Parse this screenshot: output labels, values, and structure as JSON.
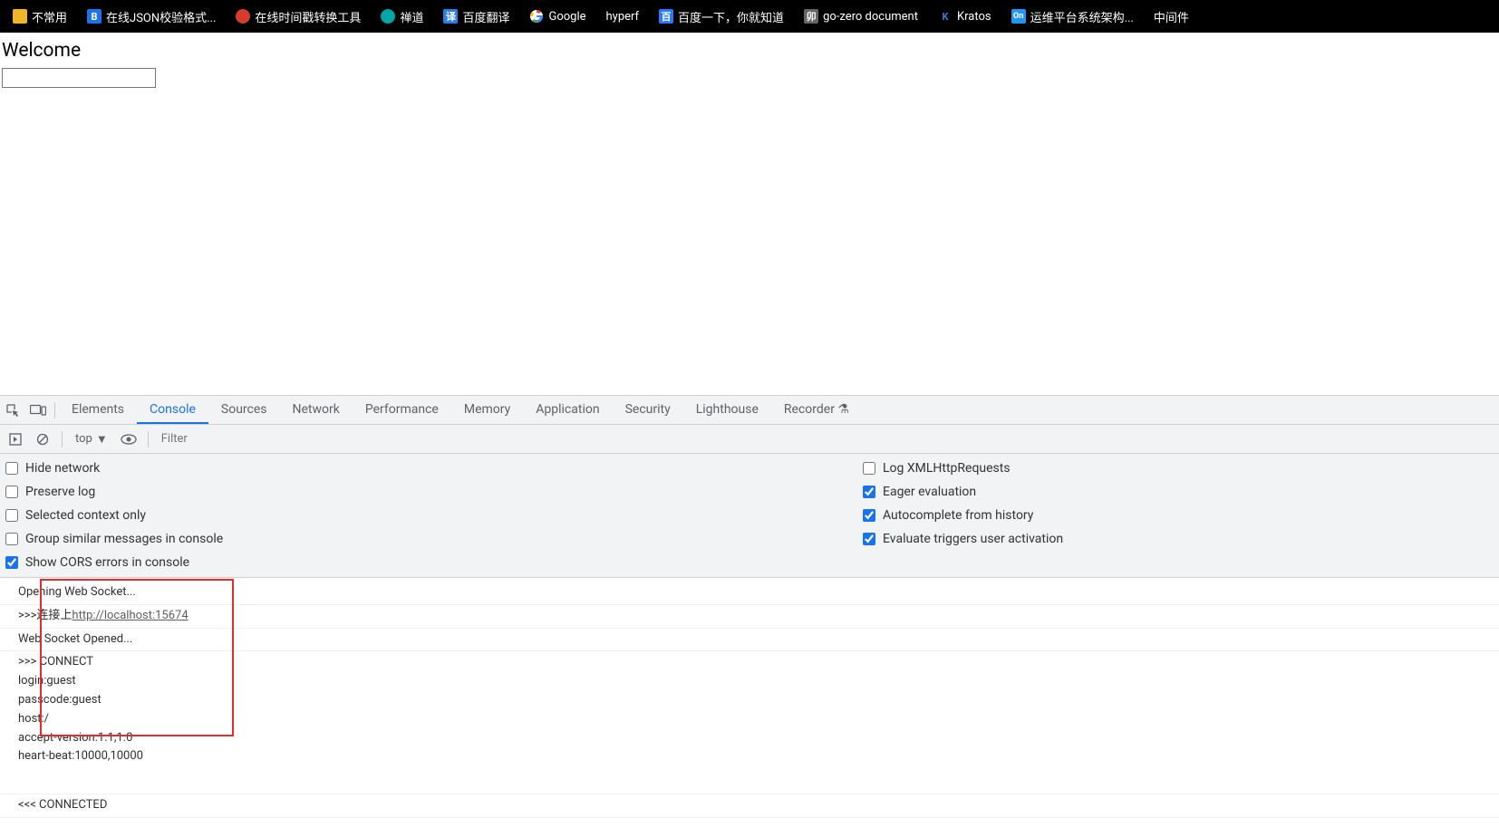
{
  "bookmarks": [
    {
      "label": "不常用",
      "icon": "folder"
    },
    {
      "label": "在线JSON校验格式...",
      "icon": "blue",
      "iconText": "B"
    },
    {
      "label": "在线时间戳转换工具",
      "icon": "red"
    },
    {
      "label": "禅道",
      "icon": "teal"
    },
    {
      "label": "百度翻译",
      "icon": "blue2",
      "iconText": "译"
    },
    {
      "label": "Google",
      "icon": "google"
    },
    {
      "label": "hyperf",
      "icon": "none"
    },
    {
      "label": "百度一下，你就知道",
      "icon": "blue3",
      "iconText": "百"
    },
    {
      "label": "go-zero document",
      "icon": "gray",
      "iconText": "卯"
    },
    {
      "label": "Kratos",
      "icon": "kratos",
      "iconText": "K"
    },
    {
      "label": "运维平台系统架构...",
      "icon": "on",
      "iconText": "On"
    },
    {
      "label": "中间件",
      "icon": "none"
    }
  ],
  "page": {
    "title": "Welcome",
    "input_value": ""
  },
  "devtools": {
    "tabs": [
      "Elements",
      "Console",
      "Sources",
      "Network",
      "Performance",
      "Memory",
      "Application",
      "Security",
      "Lighthouse",
      "Recorder"
    ],
    "active_tab": "Console",
    "context": "top",
    "filter_placeholder": "Filter",
    "settings_left": [
      {
        "label": "Hide network",
        "checked": false
      },
      {
        "label": "Preserve log",
        "checked": false
      },
      {
        "label": "Selected context only",
        "checked": false
      },
      {
        "label": "Group similar messages in console",
        "checked": false
      },
      {
        "label": "Show CORS errors in console",
        "checked": true
      }
    ],
    "settings_right": [
      {
        "label": "Log XMLHttpRequests",
        "checked": false
      },
      {
        "label": "Eager evaluation",
        "checked": true
      },
      {
        "label": "Autocomplete from history",
        "checked": true
      },
      {
        "label": "Evaluate triggers user activation",
        "checked": true
      }
    ],
    "log": {
      "l1": "Opening Web Socket...",
      "l2_prefix": ">>>连接上",
      "l2_link": "http://localhost:15674",
      "l3": "Web Socket Opened...",
      "l4": ">>> CONNECT\nlogin:guest\npasscode:guest\nhost:/\naccept-version:1.1,1.0\nheart-beat:10000,10000",
      "l5": "<<< CONNECTED"
    }
  }
}
